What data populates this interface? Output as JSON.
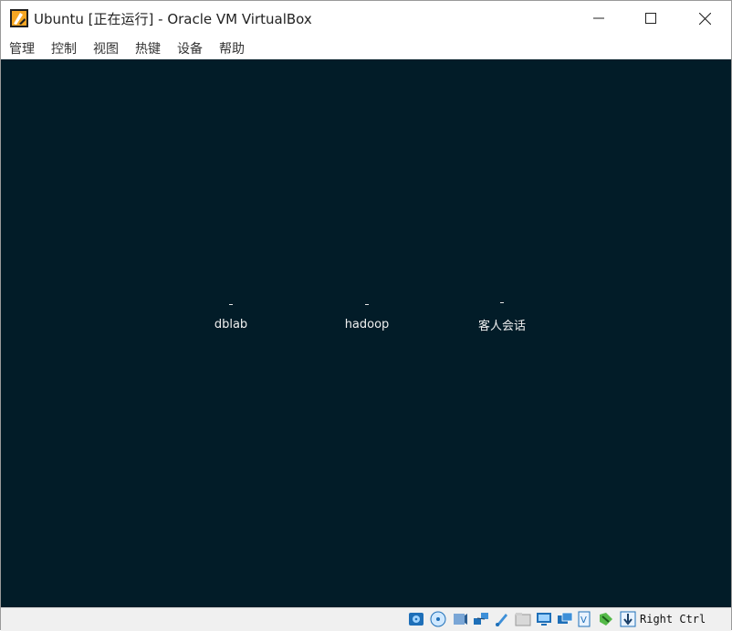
{
  "window": {
    "title": "Ubuntu [正在运行] - Oracle VM VirtualBox",
    "controls": {
      "minimize_icon": "minimize-icon",
      "maximize_icon": "maximize-icon",
      "close_icon": "close-icon"
    }
  },
  "menu": {
    "items": [
      "管理",
      "控制",
      "视图",
      "热键",
      "设备",
      "帮助"
    ]
  },
  "login": {
    "users": [
      {
        "name": "dblab"
      },
      {
        "name": "hadoop"
      },
      {
        "name": "客人会话"
      }
    ]
  },
  "statusbar": {
    "icons": [
      "hard-disk-icon",
      "optical-drive-icon",
      "audio-icon",
      "network-icon",
      "usb-icon",
      "shared-folders-icon",
      "display-icon",
      "recording-icon",
      "vt-x-icon",
      "mouse-integration-icon",
      "keyboard-capture-icon"
    ],
    "host_key": "Right Ctrl"
  },
  "colors": {
    "vm_background": "#021c28",
    "titlebar": "#ffffff",
    "statusbar": "#f0f0f0"
  }
}
